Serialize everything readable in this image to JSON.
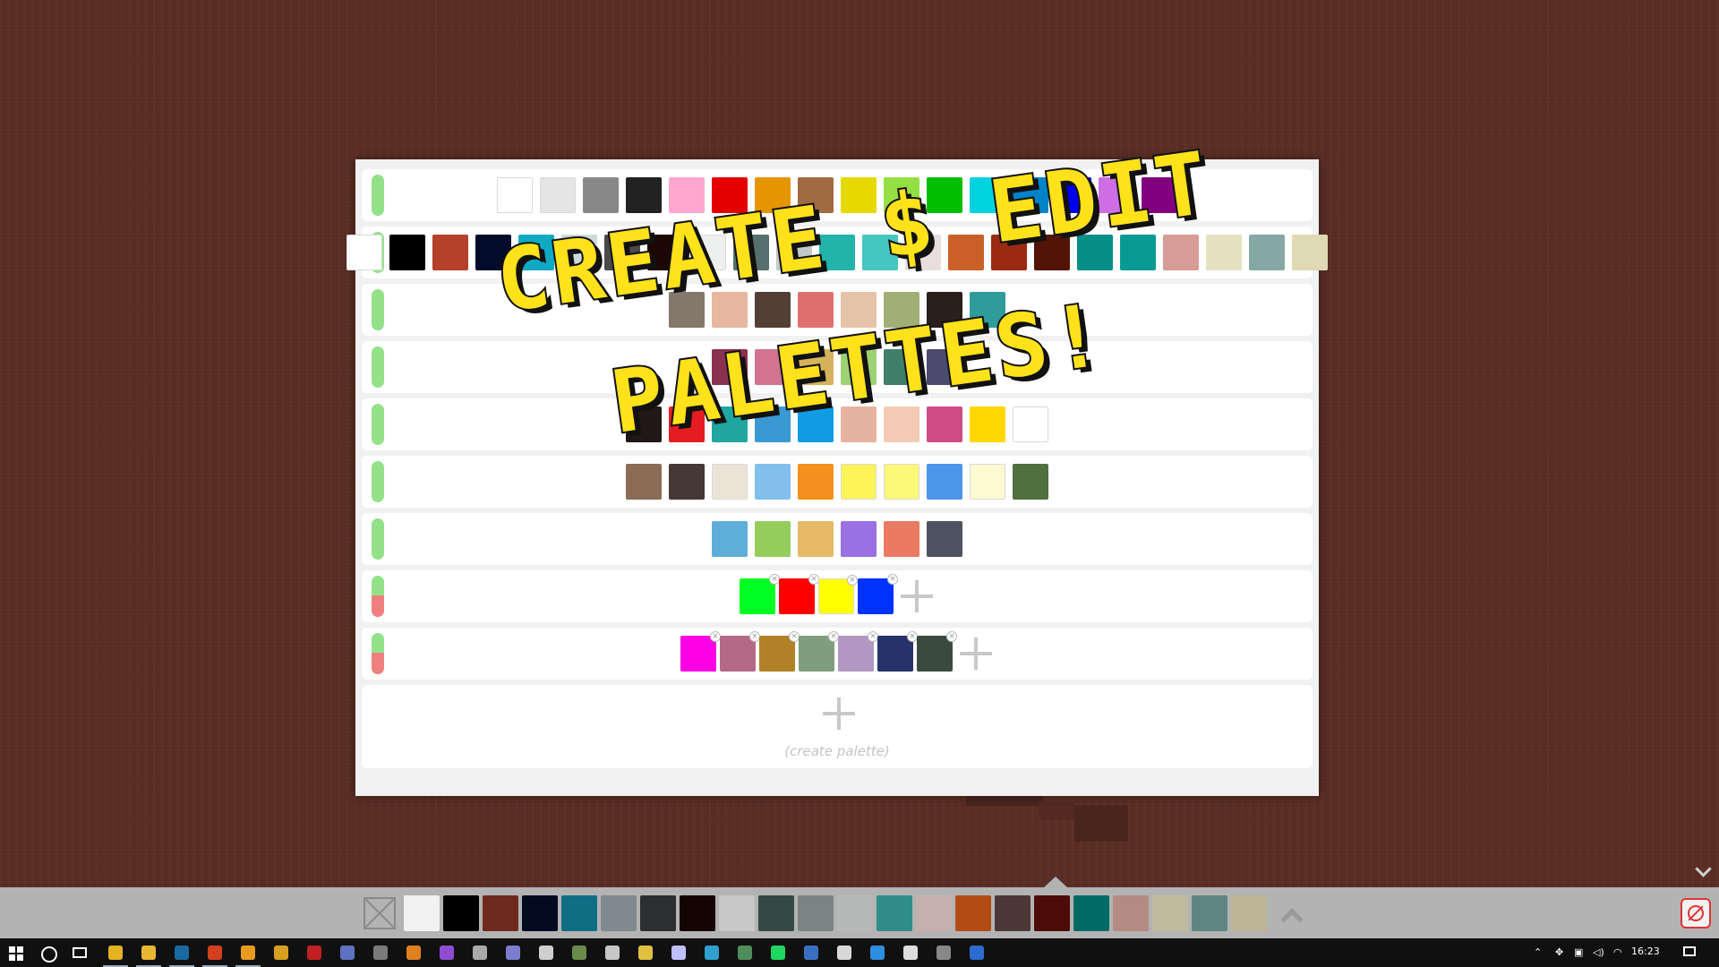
{
  "headline": {
    "line1": "CREATE $ EDIT",
    "line2": "PALETTES!"
  },
  "palettes": [
    {
      "locked": true,
      "colors": [
        "#ffffff",
        "#e5e5e5",
        "#888888",
        "#222222",
        "#ffa7d1",
        "#e50000",
        "#e59500",
        "#a06a42",
        "#e5d900",
        "#94e044",
        "#02be01",
        "#00d3dd",
        "#0083c7",
        "#0000ea",
        "#cf6ee4",
        "#820080"
      ]
    },
    {
      "locked": true,
      "colors": [
        "#ffffff",
        "#000000",
        "#b5412a",
        "#020b2a",
        "#10a9c2",
        "#ced9d9",
        "#4a4a4a",
        "#1c0705",
        "#eef0f0",
        "#56716d",
        "#c3c8c8",
        "#23b3aa",
        "#46c6c1",
        "#e8dede",
        "#c96027",
        "#9b2a12",
        "#521407",
        "#068f88",
        "#099b93",
        "#d79c97",
        "#e6e1c0",
        "#86a8a5",
        "#dfdab3"
      ]
    },
    {
      "locked": true,
      "colors": [
        "#83786a",
        "#e8b7a0",
        "#543f35",
        "#e07070",
        "#e6c3a8",
        "#a1ae75",
        "#2a1f1d",
        "#2f9b9a"
      ]
    },
    {
      "locked": true,
      "colors": [
        "#8a3150",
        "#d17391",
        "#d4b35c",
        "#9ed174",
        "#3f7f6a",
        "#4c4a6e"
      ]
    },
    {
      "locked": true,
      "colors": [
        "#221717",
        "#e51d23",
        "#1fa6a0",
        "#3a99d2",
        "#119be2",
        "#e6b3a0",
        "#f3cbb5",
        "#d04a85",
        "#ffd700",
        "#ffffff"
      ]
    },
    {
      "locked": true,
      "colors": [
        "#8b6c55",
        "#463837",
        "#ebe3d6",
        "#82bfed",
        "#f4901e",
        "#fdf458",
        "#fdf878",
        "#4d95ea",
        "#fdfad2",
        "#507040"
      ]
    },
    {
      "locked": true,
      "colors": [
        "#5eaed9",
        "#95cd5d",
        "#e6b966",
        "#9a71e3",
        "#e87b61",
        "#4c5260"
      ]
    },
    {
      "locked": false,
      "colors": [
        "#00ff22",
        "#ff0000",
        "#ffff00",
        "#0033ff"
      ]
    },
    {
      "locked": false,
      "colors": [
        "#ff00e6",
        "#b46a87",
        "#b08126",
        "#7f9d7f",
        "#b197c2",
        "#27326b",
        "#3b4a3f"
      ]
    }
  ],
  "create_palette_label": "(create palette)",
  "palette_bar": {
    "colors": [
      "#f1f1f1",
      "#000000",
      "#6e2a1e",
      "#020b1f",
      "#0f6e83",
      "#7f8a8c",
      "#2d2e31",
      "#150404",
      "#c8c8c8",
      "#354944",
      "#7b8485",
      "#b7b8b8",
      "#2f8c88",
      "#c7b1ad",
      "#b34c14",
      "#4d3838",
      "#4c0b07",
      "#006a66",
      "#b48b83",
      "#c0bb9e",
      "#5f8581",
      "#bdb593"
    ]
  },
  "taskbar": {
    "time": "16:23",
    "apps": [
      "chrome-icon",
      "file-explorer-icon",
      "steam-icon",
      "app-icon",
      "overwatch-icon",
      "app-icon",
      "app-icon",
      "app-icon",
      "app-icon",
      "app-icon",
      "visual-studio-icon",
      "app-icon",
      "app-icon",
      "app-icon",
      "app-icon",
      "app-icon",
      "app-icon",
      "app-icon",
      "app-icon",
      "app-icon",
      "spotify-icon",
      "app-icon",
      "app-icon",
      "app-icon",
      "app-icon",
      "app-icon",
      "app-icon"
    ]
  }
}
